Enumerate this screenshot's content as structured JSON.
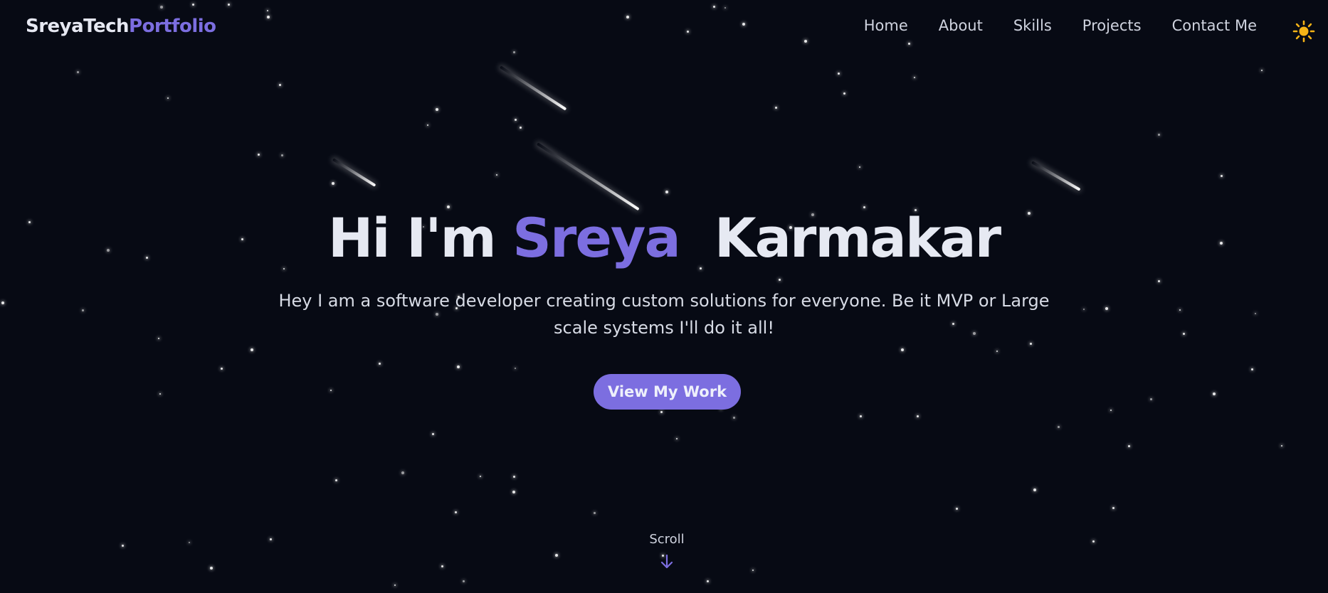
{
  "brand": {
    "name_primary": "SreyaTech",
    "name_accent": "Portfolio"
  },
  "nav": {
    "items": [
      {
        "label": "Home"
      },
      {
        "label": "About"
      },
      {
        "label": "Skills"
      },
      {
        "label": "Projects"
      },
      {
        "label": "Contact Me"
      }
    ],
    "theme_toggle_icon": "sun-icon"
  },
  "hero": {
    "greeting": "Hi I'm",
    "first_name": "Sreya",
    "last_name": "Karmakar",
    "subtitle": "Hey I am a software developer creating custom solutions for everyone. Be it MVP or Large scale systems I'll do it all!",
    "cta_label": "View My Work"
  },
  "scroll": {
    "label": "Scroll",
    "icon": "arrow-down-icon"
  },
  "colors": {
    "background": "#070a14",
    "accent": "#7c6ee0",
    "sun": "#f5b316",
    "text": "#e6e9f2"
  }
}
